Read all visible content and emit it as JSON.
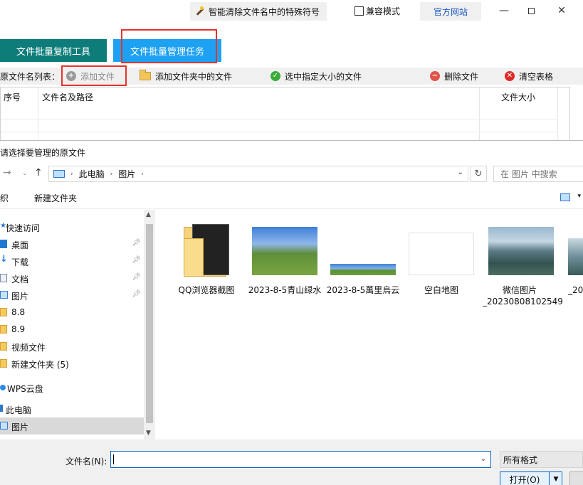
{
  "app": {
    "special_chars_button": "智能清除文件名中的特殊符号",
    "compat_mode_label": "兼容模式",
    "official_site_label": "官方网站",
    "tabs": [
      "文件批量复制工具",
      "文件批量管理任务"
    ],
    "toolbar": {
      "source_label": "原文件名列表：",
      "add_file": "添加文件",
      "add_folder_files": "添加文件夹中的文件",
      "select_by_size": "选中指定大小的文件",
      "delete_files": "删除文件",
      "clear_table": "清空表格"
    },
    "table_headers": [
      "序号",
      "文件名及路径",
      "文件大小"
    ]
  },
  "dialog": {
    "title": "请选择要管理的原文件",
    "breadcrumb": [
      "此电脑",
      "图片"
    ],
    "search_placeholder": "在 图片 中搜索",
    "organize_label": "织",
    "new_folder_label": "新建文件夹",
    "nav": [
      {
        "label": "快速访问",
        "icon": "star-icon"
      },
      {
        "label": "桌面",
        "icon": "desktop-icon",
        "pinned": true
      },
      {
        "label": "下载",
        "icon": "download-icon",
        "pinned": true
      },
      {
        "label": "文档",
        "icon": "document-icon",
        "pinned": true
      },
      {
        "label": "图片",
        "icon": "pictures-icon",
        "pinned": true
      },
      {
        "label": "8.8",
        "icon": "folder-icon"
      },
      {
        "label": "8.9",
        "icon": "folder-icon"
      },
      {
        "label": "视频文件",
        "icon": "folder-icon"
      },
      {
        "label": "新建文件夹 (5)",
        "icon": "folder-icon"
      },
      {
        "label": "WPS云盘",
        "icon": "cloud-icon"
      },
      {
        "label": "此电脑",
        "icon": "computer-icon"
      },
      {
        "label": "图片",
        "icon": "pictures-icon",
        "selected": true
      }
    ],
    "files": [
      {
        "label": "QQ浏览器截图",
        "type": "folder"
      },
      {
        "label": "2023-8-5青山绿水",
        "type": "image"
      },
      {
        "label": "2023-8-5萬里烏云",
        "type": "image"
      },
      {
        "label": "空白地图",
        "type": "image"
      },
      {
        "label": "微信图片_20230808102549",
        "type": "image"
      },
      {
        "label": "_20",
        "type": "image"
      }
    ],
    "filename_label": "文件名(N):",
    "filename_value": "",
    "filter_value": "所有格式",
    "open_label": "打开(O)"
  }
}
